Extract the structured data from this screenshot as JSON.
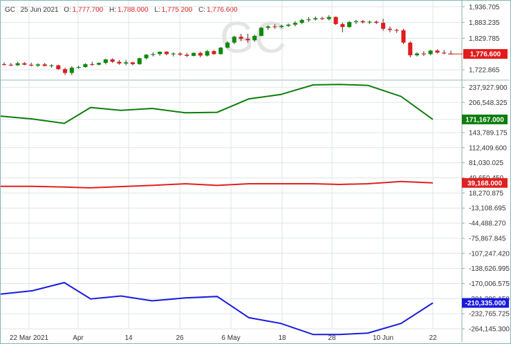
{
  "header": {
    "symbol": "GC",
    "date": "25 Jun 2021",
    "open_label": "O:",
    "open": "1,777.700",
    "high_label": "H:",
    "high": "1,788.000",
    "low_label": "L:",
    "low": "1,775.200",
    "close_label": "C:",
    "close": "1,776.600"
  },
  "watermark": "GC",
  "colors": {
    "up": "#0b8a0b",
    "down": "#e31b1b",
    "line1": "#0b7d0b",
    "line2": "#e02020",
    "line3": "#1a1adc",
    "grid": "#dde6e6"
  },
  "chart_data": [
    {
      "type": "candlestick",
      "title": "GC",
      "ylim": [
        1690,
        1955
      ],
      "ticks": [
        1936.705,
        1883.235,
        1829.785,
        1776.6,
        1722.865
      ],
      "tick_labels": [
        "1,936.705",
        "1,883.235",
        "1,829.785",
        "1,776.600",
        "1,722.865"
      ],
      "last_value_label": "1,776.600",
      "candles": [
        {
          "o": 1742,
          "h": 1748,
          "l": 1737,
          "c": 1740
        },
        {
          "o": 1740,
          "h": 1746,
          "l": 1735,
          "c": 1738
        },
        {
          "o": 1738,
          "h": 1750,
          "l": 1736,
          "c": 1745
        },
        {
          "o": 1745,
          "h": 1749,
          "l": 1738,
          "c": 1740
        },
        {
          "o": 1740,
          "h": 1747,
          "l": 1734,
          "c": 1737
        },
        {
          "o": 1737,
          "h": 1745,
          "l": 1732,
          "c": 1741
        },
        {
          "o": 1741,
          "h": 1746,
          "l": 1734,
          "c": 1736
        },
        {
          "o": 1736,
          "h": 1742,
          "l": 1730,
          "c": 1738
        },
        {
          "o": 1738,
          "h": 1740,
          "l": 1722,
          "c": 1725
        },
        {
          "o": 1725,
          "h": 1730,
          "l": 1705,
          "c": 1712
        },
        {
          "o": 1712,
          "h": 1735,
          "l": 1705,
          "c": 1730
        },
        {
          "o": 1730,
          "h": 1737,
          "l": 1726,
          "c": 1732
        },
        {
          "o": 1732,
          "h": 1745,
          "l": 1730,
          "c": 1742
        },
        {
          "o": 1742,
          "h": 1750,
          "l": 1736,
          "c": 1740
        },
        {
          "o": 1740,
          "h": 1748,
          "l": 1738,
          "c": 1746
        },
        {
          "o": 1746,
          "h": 1760,
          "l": 1741,
          "c": 1758
        },
        {
          "o": 1758,
          "h": 1762,
          "l": 1746,
          "c": 1750
        },
        {
          "o": 1750,
          "h": 1756,
          "l": 1740,
          "c": 1744
        },
        {
          "o": 1744,
          "h": 1756,
          "l": 1738,
          "c": 1748
        },
        {
          "o": 1748,
          "h": 1750,
          "l": 1738,
          "c": 1742
        },
        {
          "o": 1742,
          "h": 1764,
          "l": 1740,
          "c": 1762
        },
        {
          "o": 1762,
          "h": 1776,
          "l": 1758,
          "c": 1774
        },
        {
          "o": 1774,
          "h": 1782,
          "l": 1768,
          "c": 1776
        },
        {
          "o": 1776,
          "h": 1785,
          "l": 1770,
          "c": 1784
        },
        {
          "o": 1784,
          "h": 1786,
          "l": 1772,
          "c": 1776
        },
        {
          "o": 1776,
          "h": 1782,
          "l": 1768,
          "c": 1778
        },
        {
          "o": 1778,
          "h": 1782,
          "l": 1770,
          "c": 1774
        },
        {
          "o": 1774,
          "h": 1780,
          "l": 1766,
          "c": 1770
        },
        {
          "o": 1770,
          "h": 1782,
          "l": 1768,
          "c": 1780
        },
        {
          "o": 1780,
          "h": 1784,
          "l": 1765,
          "c": 1771
        },
        {
          "o": 1771,
          "h": 1790,
          "l": 1768,
          "c": 1786
        },
        {
          "o": 1786,
          "h": 1790,
          "l": 1774,
          "c": 1776
        },
        {
          "o": 1776,
          "h": 1800,
          "l": 1774,
          "c": 1798
        },
        {
          "o": 1798,
          "h": 1820,
          "l": 1795,
          "c": 1815
        },
        {
          "o": 1815,
          "h": 1838,
          "l": 1810,
          "c": 1835
        },
        {
          "o": 1835,
          "h": 1845,
          "l": 1820,
          "c": 1828
        },
        {
          "o": 1828,
          "h": 1845,
          "l": 1815,
          "c": 1823
        },
        {
          "o": 1823,
          "h": 1842,
          "l": 1818,
          "c": 1838
        },
        {
          "o": 1838,
          "h": 1868,
          "l": 1836,
          "c": 1865
        },
        {
          "o": 1865,
          "h": 1874,
          "l": 1858,
          "c": 1870
        },
        {
          "o": 1870,
          "h": 1878,
          "l": 1862,
          "c": 1868
        },
        {
          "o": 1868,
          "h": 1876,
          "l": 1864,
          "c": 1872
        },
        {
          "o": 1872,
          "h": 1880,
          "l": 1868,
          "c": 1876
        },
        {
          "o": 1876,
          "h": 1888,
          "l": 1870,
          "c": 1882
        },
        {
          "o": 1882,
          "h": 1896,
          "l": 1878,
          "c": 1892
        },
        {
          "o": 1892,
          "h": 1902,
          "l": 1885,
          "c": 1894
        },
        {
          "o": 1894,
          "h": 1904,
          "l": 1890,
          "c": 1898
        },
        {
          "o": 1898,
          "h": 1903,
          "l": 1892,
          "c": 1895
        },
        {
          "o": 1895,
          "h": 1908,
          "l": 1890,
          "c": 1902
        },
        {
          "o": 1902,
          "h": 1904,
          "l": 1875,
          "c": 1878
        },
        {
          "o": 1878,
          "h": 1883,
          "l": 1850,
          "c": 1868
        },
        {
          "o": 1868,
          "h": 1888,
          "l": 1865,
          "c": 1885
        },
        {
          "o": 1885,
          "h": 1892,
          "l": 1878,
          "c": 1888
        },
        {
          "o": 1888,
          "h": 1892,
          "l": 1880,
          "c": 1884
        },
        {
          "o": 1884,
          "h": 1890,
          "l": 1878,
          "c": 1886
        },
        {
          "o": 1886,
          "h": 1890,
          "l": 1878,
          "c": 1882
        },
        {
          "o": 1882,
          "h": 1896,
          "l": 1855,
          "c": 1862
        },
        {
          "o": 1862,
          "h": 1870,
          "l": 1850,
          "c": 1858
        },
        {
          "o": 1858,
          "h": 1862,
          "l": 1848,
          "c": 1857
        },
        {
          "o": 1857,
          "h": 1862,
          "l": 1810,
          "c": 1815
        },
        {
          "o": 1815,
          "h": 1820,
          "l": 1765,
          "c": 1772
        },
        {
          "o": 1772,
          "h": 1782,
          "l": 1768,
          "c": 1778
        },
        {
          "o": 1778,
          "h": 1786,
          "l": 1770,
          "c": 1776
        },
        {
          "o": 1776,
          "h": 1790,
          "l": 1772,
          "c": 1788
        },
        {
          "o": 1788,
          "h": 1792,
          "l": 1778,
          "c": 1781
        },
        {
          "o": 1781,
          "h": 1790,
          "l": 1775,
          "c": 1779
        },
        {
          "o": 1777.7,
          "h": 1788,
          "l": 1775.2,
          "c": 1776.6
        }
      ]
    },
    {
      "type": "line",
      "ylim": [
        -290000,
        250000
      ],
      "ticks": [
        237927.9,
        206548.325,
        171167,
        143789.175,
        112409.6,
        81030.025,
        49650.45,
        18270.875,
        -13108.695,
        -44488.27,
        -75867.845,
        -107247.42,
        -138626.995,
        -170006.575,
        -201386.15,
        -232765.725,
        -264145.3
      ],
      "tick_labels": [
        "237,927.900",
        "206,548.325",
        "171,167.000",
        "143,789.175",
        "112,409.600",
        "81,030.025",
        "49,650.450",
        "18,270.875",
        "-13,108.695",
        "-44,488.270",
        "-75,867.845",
        "-107,247.420",
        "-138,626.995",
        "-170,006.575",
        "-201,386.150",
        "-232,765.725",
        "-264,145.300"
      ],
      "series": [
        {
          "values": [
            178000,
            172000,
            163000,
            196000,
            190000,
            194000,
            185000,
            186000,
            214000,
            223000,
            243000,
            244000,
            242000,
            219000,
            171167
          ],
          "last_value_label": "171,167.000"
        },
        {
          "values": [
            32000,
            32000,
            30500,
            29000,
            31500,
            34000,
            37500,
            34000,
            37500,
            37500,
            37500,
            36000,
            37500,
            42000,
            39168
          ],
          "last_value_label": "39,168.000"
        },
        {
          "values": [
            -192000,
            -185000,
            -168000,
            -202000,
            -196000,
            -206000,
            -200000,
            -197000,
            -241000,
            -253000,
            -276000,
            -276000,
            -273000,
            -253000,
            -210335
          ],
          "last_value_label": "-210,335.000"
        }
      ]
    }
  ],
  "xaxis": {
    "labels": [
      "22 Mar 2021",
      "Apr",
      "14",
      "26",
      "6 May",
      "18",
      "28",
      "10 Jun",
      "22"
    ]
  }
}
